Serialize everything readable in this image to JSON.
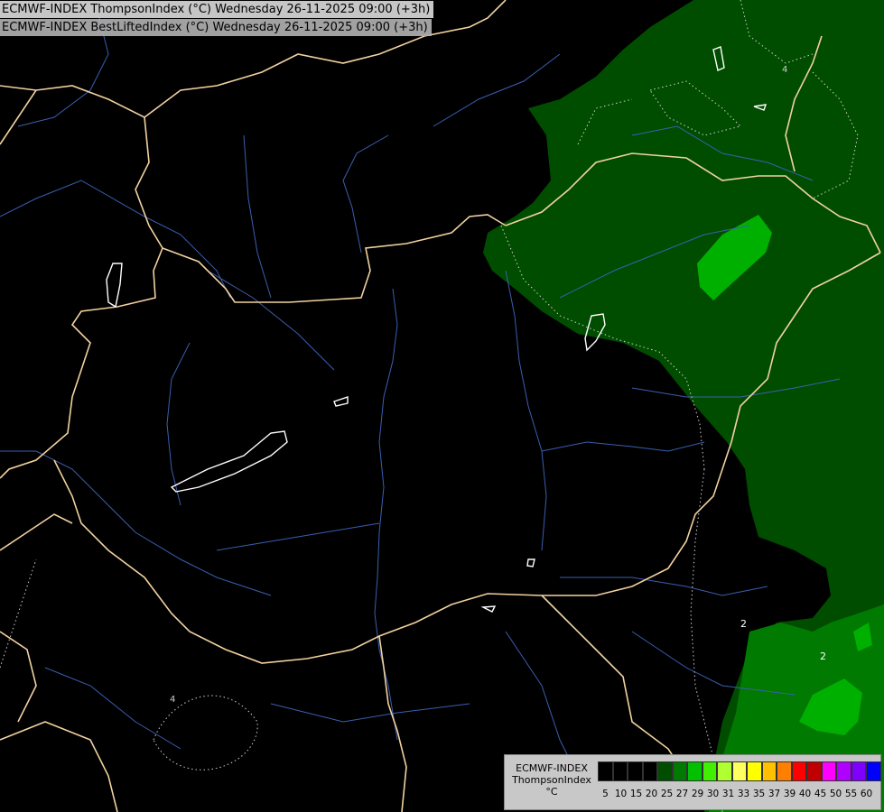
{
  "header": {
    "title_line1": "ECMWF-INDEX ThompsonIndex (°C) Wednesday 26-11-2025 09:00 (+3h)",
    "title_line2": "ECMWF-INDEX BestLiftedIndex (°C) Wednesday 26-11-2025 09:00 (+3h)"
  },
  "map": {
    "contour_labels": [
      "2",
      "2",
      "4",
      "4"
    ],
    "colors": {
      "background": "#000000",
      "dark_green": "#004d00",
      "mid_green": "#007a00",
      "bright_green": "#00b000",
      "border": "#f2d2a0",
      "river": "#3a5fb0",
      "lake_outline": "#ffffff"
    }
  },
  "legend": {
    "label_line1": "ECMWF-INDEX",
    "label_line2": "ThompsonIndex",
    "label_line3": "°C",
    "ticks": [
      "5",
      "10",
      "15",
      "20",
      "25",
      "27",
      "29",
      "30",
      "31",
      "33",
      "35",
      "37",
      "39",
      "40",
      "45",
      "50",
      "55",
      "60"
    ],
    "swatch_colors": [
      "#000000",
      "#000000",
      "#000000",
      "#000000",
      "#004d00",
      "#007a00",
      "#00c000",
      "#40f000",
      "#b0ff30",
      "#ffff60",
      "#ffff00",
      "#ffc000",
      "#ff8000",
      "#ff0000",
      "#c00000",
      "#ff00ff",
      "#b000ff",
      "#8000ff",
      "#0000ff"
    ]
  }
}
